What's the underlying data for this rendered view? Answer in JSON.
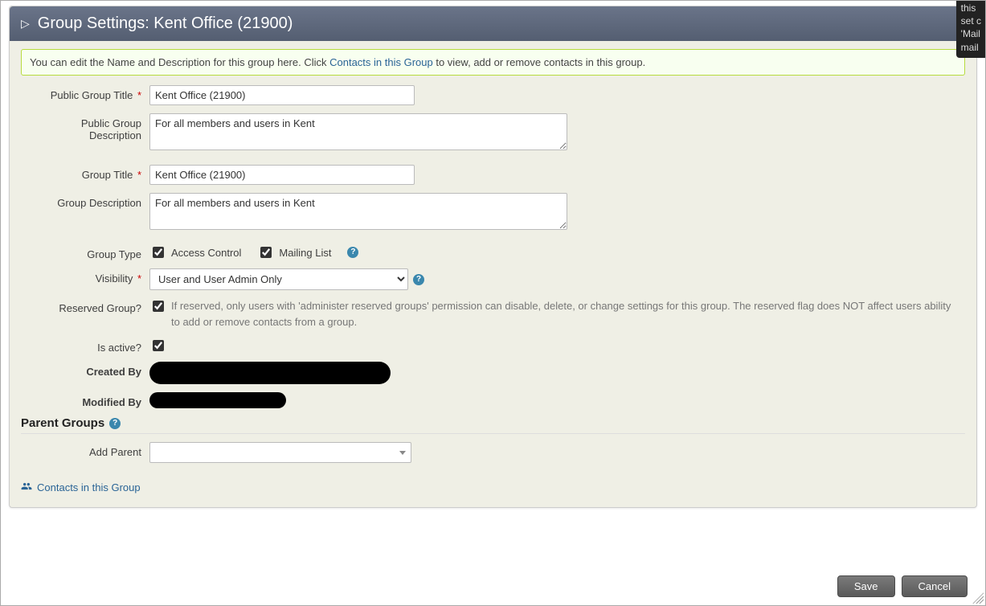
{
  "header": {
    "title": "Group Settings: Kent Office (21900)"
  },
  "info": {
    "before_link": "You can edit the Name and Description for this group here. Click ",
    "link_text": "Contacts in this Group",
    "after_link": " to view, add or remove contacts in this group."
  },
  "labels": {
    "public_title": "Public Group Title",
    "public_desc_line1": "Public Group",
    "public_desc_line2": "Description",
    "group_title": "Group Title",
    "group_desc": "Group Description",
    "group_type": "Group Type",
    "visibility": "Visibility",
    "reserved": "Reserved Group?",
    "is_active": "Is active?",
    "created_by": "Created By",
    "modified_by": "Modified By",
    "parent_groups": "Parent Groups",
    "add_parent": "Add Parent"
  },
  "values": {
    "public_title": "Kent Office (21900)",
    "public_desc": "For all members and users in Kent",
    "group_title": "Kent Office (21900)",
    "group_desc": "For all members and users in Kent",
    "access_control_checked": true,
    "mailing_list_checked": true,
    "visibility_selected": "User and User Admin Only",
    "reserved_checked": true,
    "is_active_checked": true
  },
  "group_type_options": {
    "access_control": "Access Control",
    "mailing_list": "Mailing List"
  },
  "reserved_help": "If reserved, only users with 'administer reserved groups' permission can disable, delete, or change settings for this group. The reserved flag does NOT affect users ability to add or remove contacts from a group.",
  "contacts_link": "Contacts in this Group",
  "buttons": {
    "save": "Save",
    "cancel": "Cancel"
  },
  "tooltip_fragment": {
    "l1": "this",
    "l2": "set c",
    "l3": "'Mail",
    "l4": "mail"
  },
  "help_glyph": "?"
}
